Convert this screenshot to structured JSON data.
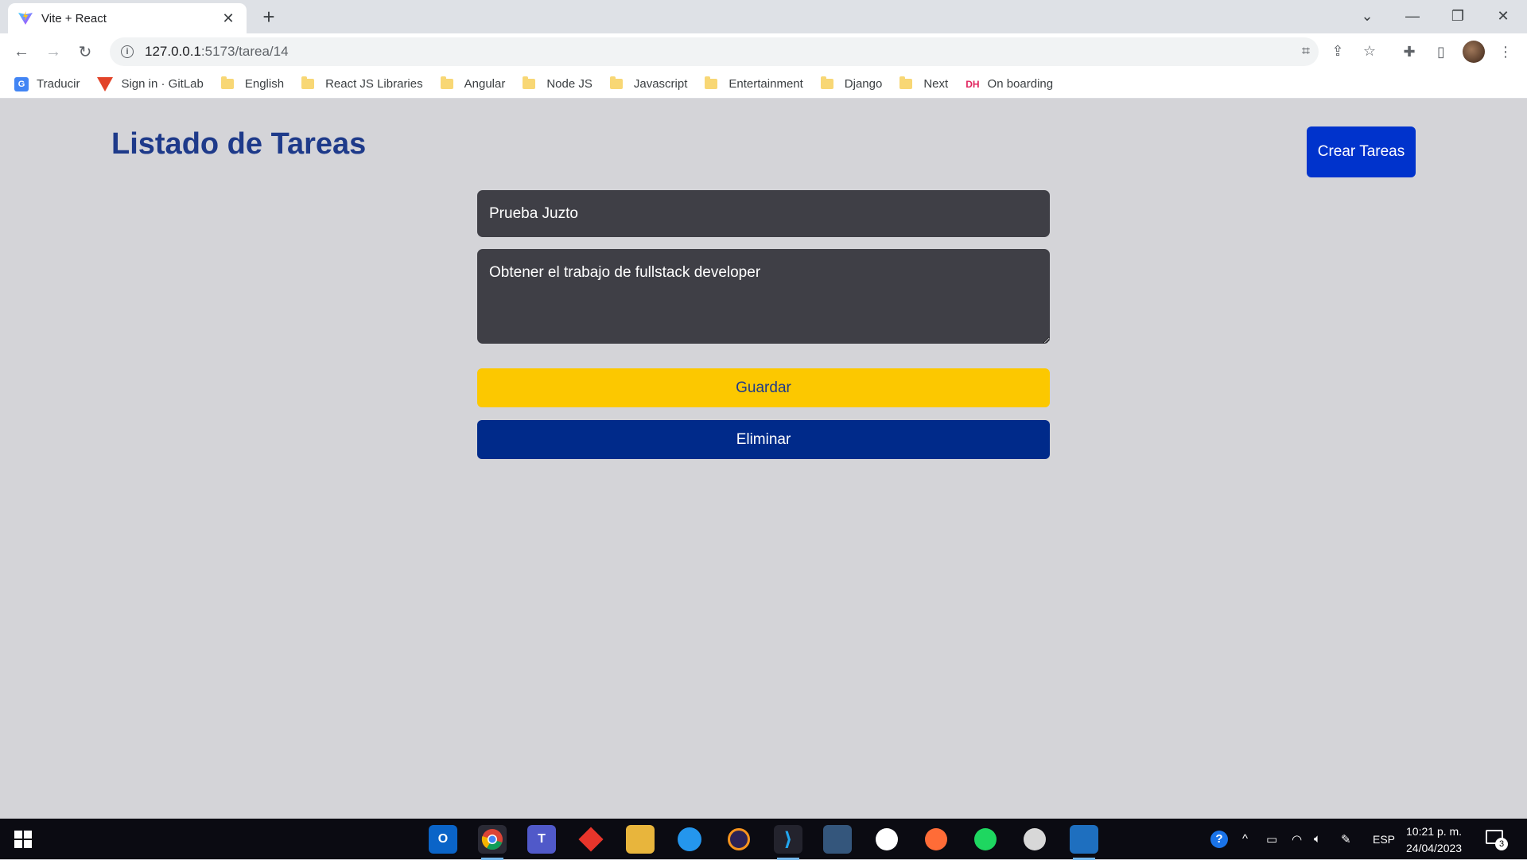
{
  "browser": {
    "tab_title": "Vite + React",
    "tab_close": "✕",
    "new_tab": "+",
    "url_host": "127.0.0.1",
    "url_path": ":5173/tarea/14",
    "bookmarks": [
      {
        "label": "Traducir",
        "icon": "google-translate-icon"
      },
      {
        "label": "Sign in · GitLab",
        "icon": "gitlab-icon"
      },
      {
        "label": "English",
        "icon": "folder-icon"
      },
      {
        "label": "React JS Libraries",
        "icon": "folder-icon"
      },
      {
        "label": "Angular",
        "icon": "folder-icon"
      },
      {
        "label": "Node JS",
        "icon": "folder-icon"
      },
      {
        "label": "Javascript",
        "icon": "folder-icon"
      },
      {
        "label": "Entertainment",
        "icon": "folder-icon"
      },
      {
        "label": "Django",
        "icon": "folder-icon"
      },
      {
        "label": "Next",
        "icon": "folder-icon"
      },
      {
        "label": "On boarding",
        "icon": "dh-icon"
      }
    ]
  },
  "page": {
    "title": "Listado de Tareas",
    "create_button": "Crear Tareas",
    "form": {
      "title_value": "Prueba Juzto",
      "description_value": "Obtener el trabajo de fullstack developer",
      "save_button": "Guardar",
      "delete_button": "Eliminar"
    }
  },
  "taskbar": {
    "language": "ESP",
    "time": "10:21 p. m.",
    "date": "24/04/2023",
    "notification_count": "3"
  },
  "colors": {
    "page_bg": "#d4d4d8",
    "title": "#1e3a8a",
    "create_button": "#0033cc",
    "input_bg": "#3f3f46",
    "save_button": "#fcc800",
    "delete_button": "#002a8a"
  }
}
